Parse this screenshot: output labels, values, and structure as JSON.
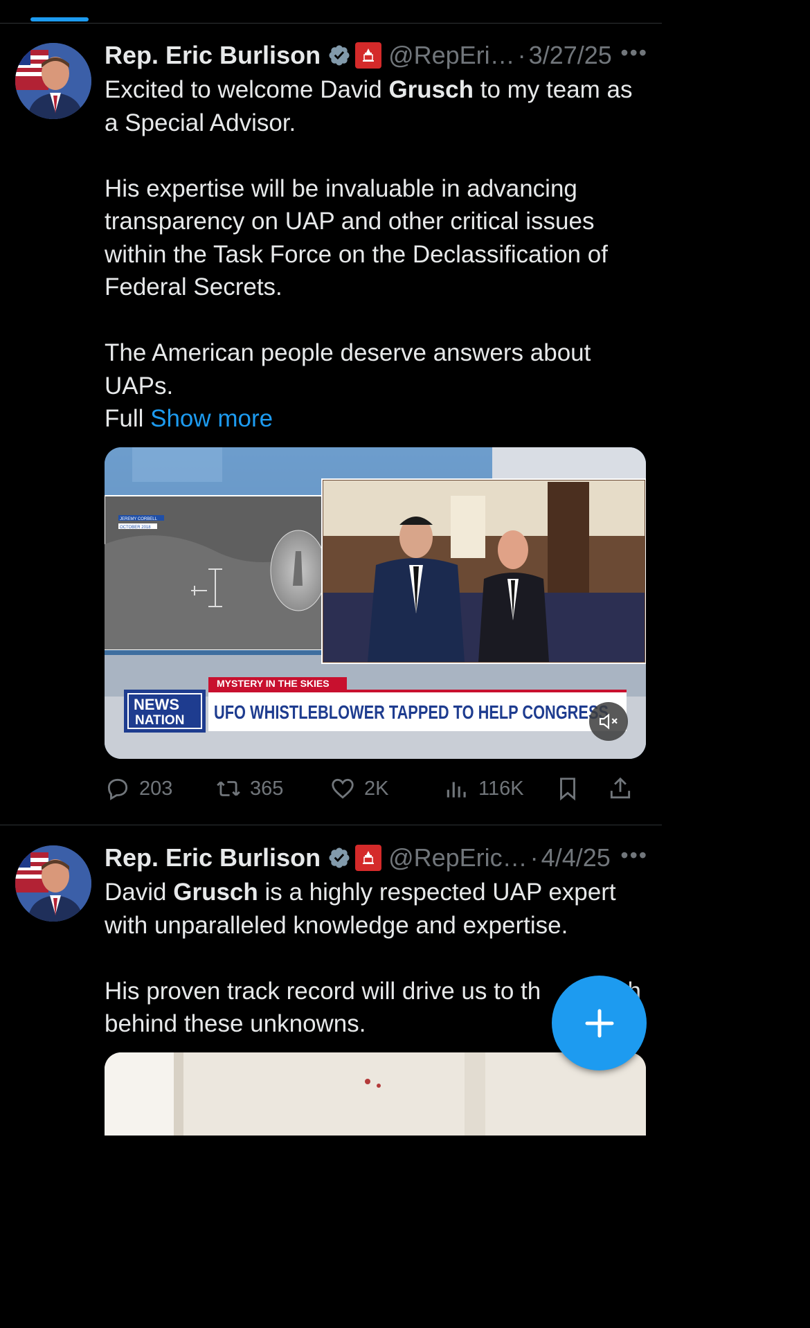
{
  "tweets": [
    {
      "author_name": "Rep. Eric Burlison",
      "handle": "@RepEri…",
      "separator": "·",
      "date": "3/27/25",
      "more": "•••",
      "text_a1": "Excited to welcome David ",
      "text_a2": "Grusch",
      "text_a3": " to my team as a Special Advisor.",
      "text_b": "His expertise will be invaluable in advancing transparency on UAP and other critical issues within the Task Force on the Declassification of Federal Secrets.",
      "text_c": "The American people deserve answers about UAPs.",
      "text_d": "Full ",
      "show_more": "Show more",
      "video": {
        "inset_label_1": "JEREMY CORBELL",
        "inset_label_2": "OCTOBER 2018",
        "banner_kicker": "MYSTERY IN THE SKIES",
        "logo_top": "NEWS",
        "logo_bottom": "NATION",
        "headline": "UFO WHISTLEBLOWER TAPPED TO HELP CONGRESS",
        "muted": true
      },
      "stats": {
        "replies": "203",
        "reposts": "365",
        "likes": "2K",
        "views": "116K"
      }
    },
    {
      "author_name": "Rep. Eric Burlison",
      "handle": "@RepEric…",
      "separator": "·",
      "date": "4/4/25",
      "more": "•••",
      "text_a1": "David ",
      "text_a2": "Grusch",
      "text_a3": " is a highly respected UAP expert with unparalleled knowledge and expertise.",
      "text_b": "His proven track record will drive us to th",
      "text_b_end": "h",
      "text_c": "behind these unknowns."
    }
  ],
  "icons": {
    "reply": "reply-icon",
    "repost": "repost-icon",
    "like": "heart-icon",
    "views": "views-icon",
    "bookmark": "bookmark-icon",
    "share": "share-icon",
    "compose": "plus-icon"
  },
  "colors": {
    "accent": "#1d9bf0",
    "background": "#000000",
    "text": "#e7e9ea",
    "muted": "#71767b",
    "news_red": "#c8102e"
  }
}
